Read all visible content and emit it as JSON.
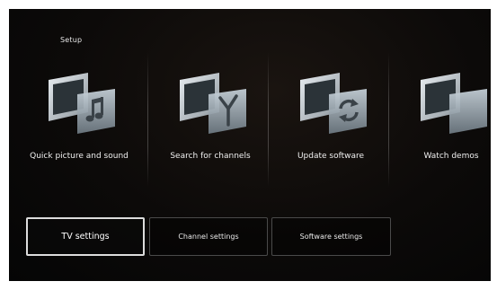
{
  "header": {
    "title": "Setup"
  },
  "tiles": [
    {
      "label": "Quick picture and sound",
      "icon": "music-note-icon"
    },
    {
      "label": "Search for channels",
      "icon": "antenna-icon"
    },
    {
      "label": "Update software",
      "icon": "refresh-icon"
    },
    {
      "label": "Watch demos",
      "icon": "demo-icon"
    }
  ],
  "bottom_menu": [
    {
      "label": "TV settings",
      "selected": true
    },
    {
      "label": "Channel settings",
      "selected": false
    },
    {
      "label": "Software settings",
      "selected": false
    }
  ],
  "colors": {
    "background": "#0a0808",
    "text": "#f0f0f0",
    "selected_border": "#dcdcdc"
  }
}
